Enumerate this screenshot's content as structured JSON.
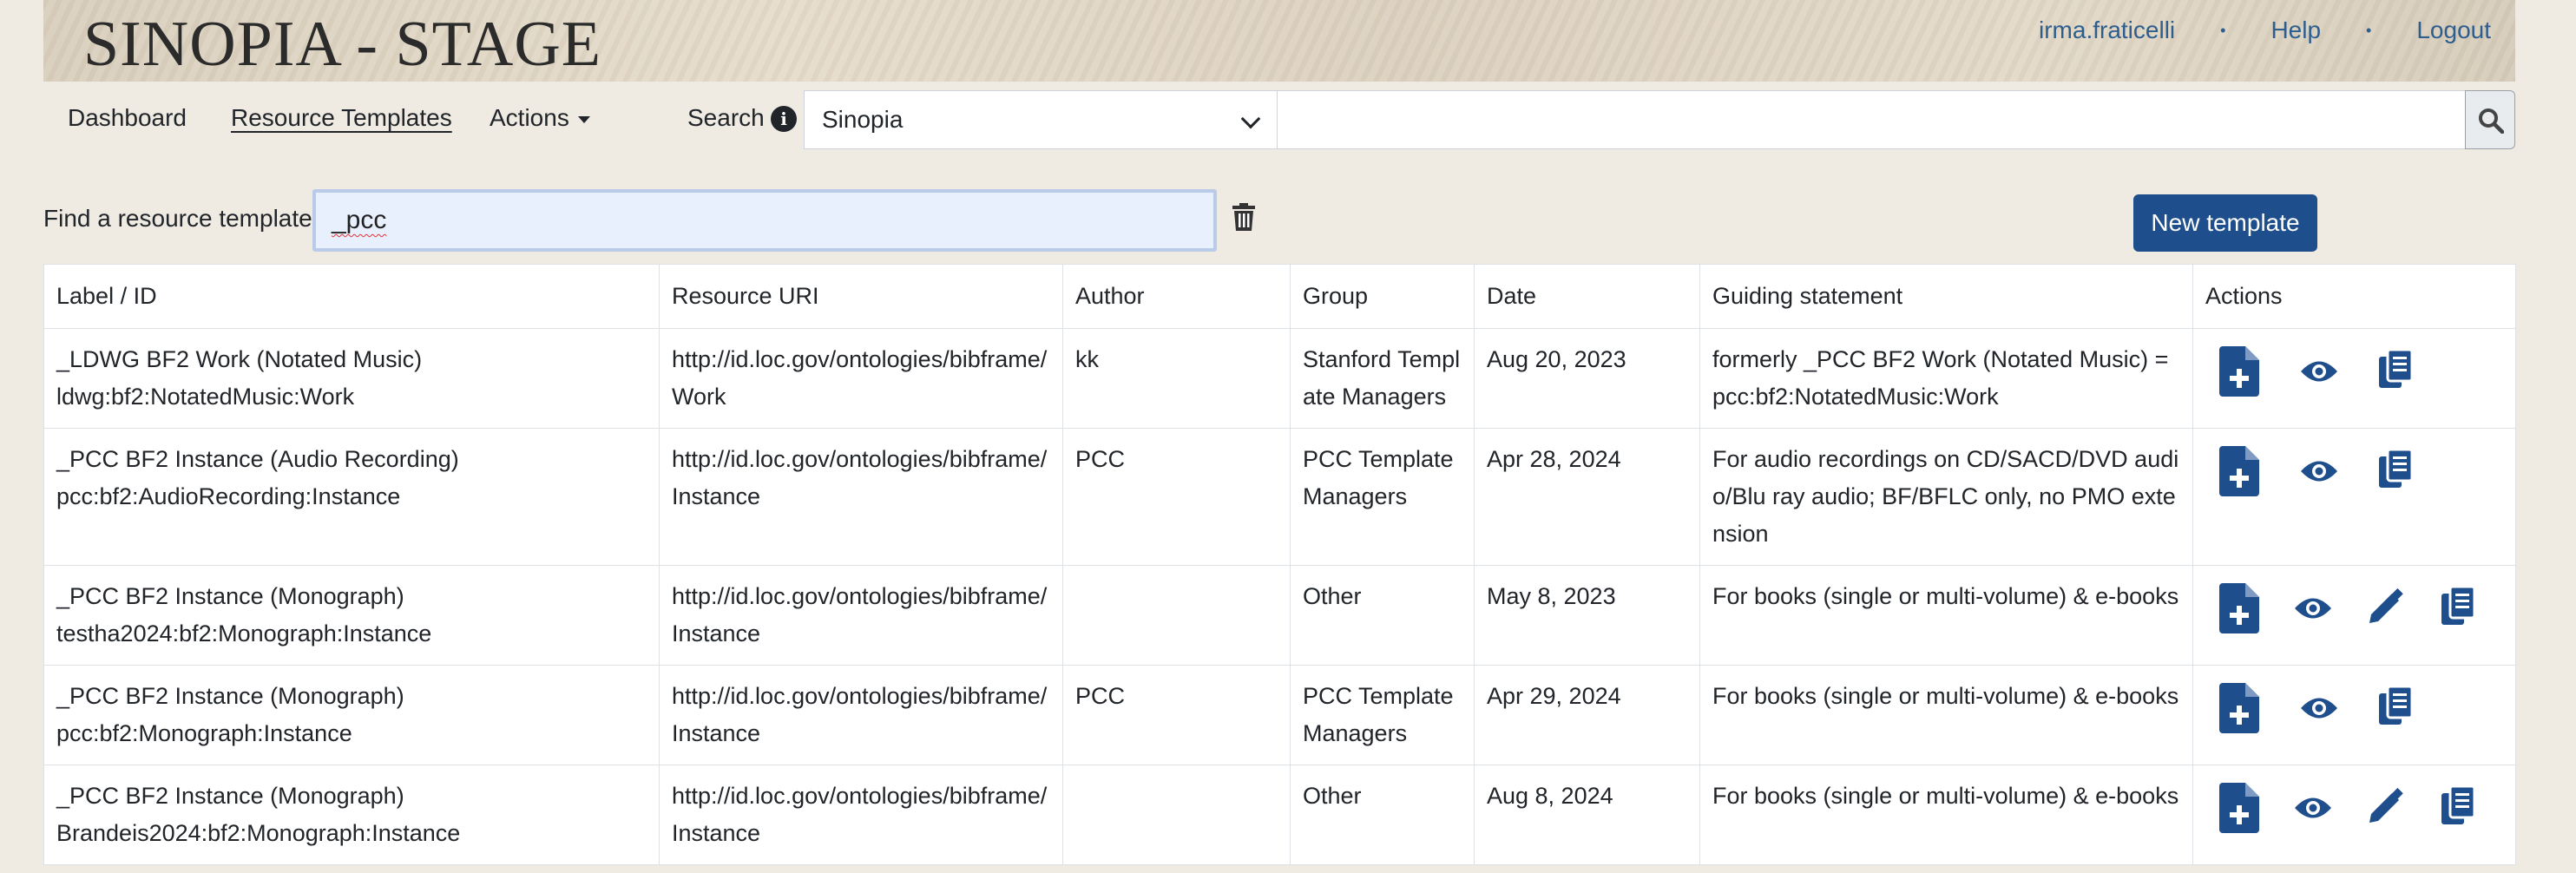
{
  "header": {
    "title": "SINOPIA - STAGE",
    "user": "irma.fraticelli",
    "help": "Help",
    "logout": "Logout"
  },
  "nav": {
    "dashboard": "Dashboard",
    "resource_templates": "Resource Templates",
    "actions": "Actions",
    "search_label": "Search",
    "search_scope": "Sinopia",
    "search_value": ""
  },
  "find": {
    "label": "Find a resource template",
    "value": "_pcc",
    "new_template": "New template"
  },
  "table": {
    "headers": [
      "Label / ID",
      "Resource URI",
      "Author",
      "Group",
      "Date",
      "Guiding statement",
      "Actions"
    ],
    "rows": [
      {
        "label": "_LDWG BF2 Work (Notated Music)",
        "id": "ldwg:bf2:NotatedMusic:Work",
        "uri": "http://id.loc.gov/ontologies/bibframe/Work",
        "author": "kk",
        "group": "Stanford Template Managers",
        "date": "Aug 20, 2023",
        "guiding": "formerly _PCC BF2 Work (Notated Music) = pcc:bf2:NotatedMusic:Work",
        "actions": [
          "new-resource",
          "view",
          "copy"
        ]
      },
      {
        "label": "_PCC BF2 Instance (Audio Recording)",
        "id": "pcc:bf2:AudioRecording:Instance",
        "uri": "http://id.loc.gov/ontologies/bibframe/Instance",
        "author": "PCC",
        "group": "PCC Template Managers",
        "date": "Apr 28, 2024",
        "guiding": "For audio recordings on CD/SACD/DVD audio/Blu ray audio; BF/BFLC only, no PMO extension",
        "actions": [
          "new-resource",
          "view",
          "copy"
        ]
      },
      {
        "label": "_PCC BF2 Instance (Monograph)",
        "id": "testha2024:bf2:Monograph:Instance",
        "uri": "http://id.loc.gov/ontologies/bibframe/Instance",
        "author": "",
        "group": "Other",
        "date": "May 8, 2023",
        "guiding": "For books (single or multi-volume) & e-books",
        "actions": [
          "new-resource",
          "view",
          "edit",
          "copy"
        ]
      },
      {
        "label": "_PCC BF2 Instance (Monograph)",
        "id": "pcc:bf2:Monograph:Instance",
        "uri": "http://id.loc.gov/ontologies/bibframe/Instance",
        "author": "PCC",
        "group": "PCC Template Managers",
        "date": "Apr 29, 2024",
        "guiding": "For books (single or multi-volume) & e-books",
        "actions": [
          "new-resource",
          "view",
          "copy"
        ]
      },
      {
        "label": "_PCC BF2 Instance (Monograph)",
        "id": "Brandeis2024:bf2:Monograph:Instance",
        "uri": "http://id.loc.gov/ontologies/bibframe/Instance",
        "author": "",
        "group": "Other",
        "date": "Aug 8, 2024",
        "guiding": "For books (single or multi-volume) & e-books",
        "actions": [
          "new-resource",
          "view",
          "edit",
          "copy"
        ]
      }
    ]
  },
  "colors": {
    "accent": "#1f4e8c",
    "link": "#2e5e8e",
    "background": "#efebe3"
  }
}
